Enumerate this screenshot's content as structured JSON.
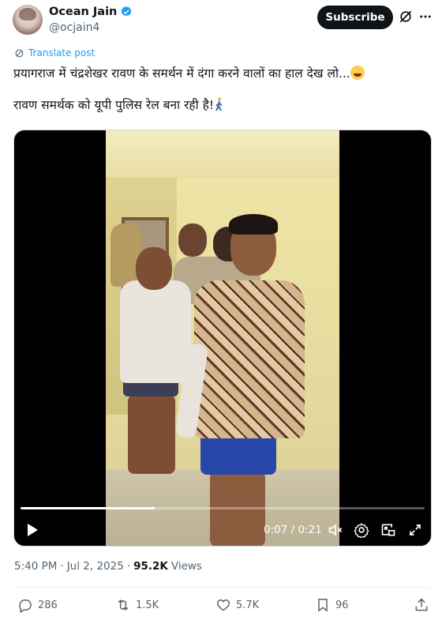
{
  "author": {
    "display_name": "Ocean Jain",
    "handle": "@ocjain4",
    "verified_icon": "verified-badge-icon"
  },
  "header": {
    "subscribe_label": "Subscribe",
    "grok_icon": "grok-icon",
    "more_icon": "more-icon"
  },
  "translate_label": "Translate post",
  "tweet": {
    "line1": "प्रयागराज में चंद्रशेखर रावण के समर्थन में दंगा करने वालों का हाल देख लो...",
    "line2": "रावण समर्थक को यूपी पुलिस रेल बना रही है!"
  },
  "video": {
    "time": "0:07 / 0:21",
    "progress_fraction": 0.333,
    "controls": [
      "play-icon",
      "mute-icon",
      "settings-icon",
      "pip-icon",
      "fullscreen-icon"
    ]
  },
  "meta": {
    "time": "5:40 PM",
    "separator": "·",
    "date": "Jul 2, 2025",
    "views_count": "95.2K",
    "views_label": "Views"
  },
  "actions": {
    "replies": "286",
    "retweets": "1.5K",
    "likes": "5.7K",
    "bookmarks": "96"
  },
  "colors": {
    "accent": "#1d9bf0",
    "text": "#0f1419",
    "secondary": "#536471"
  }
}
